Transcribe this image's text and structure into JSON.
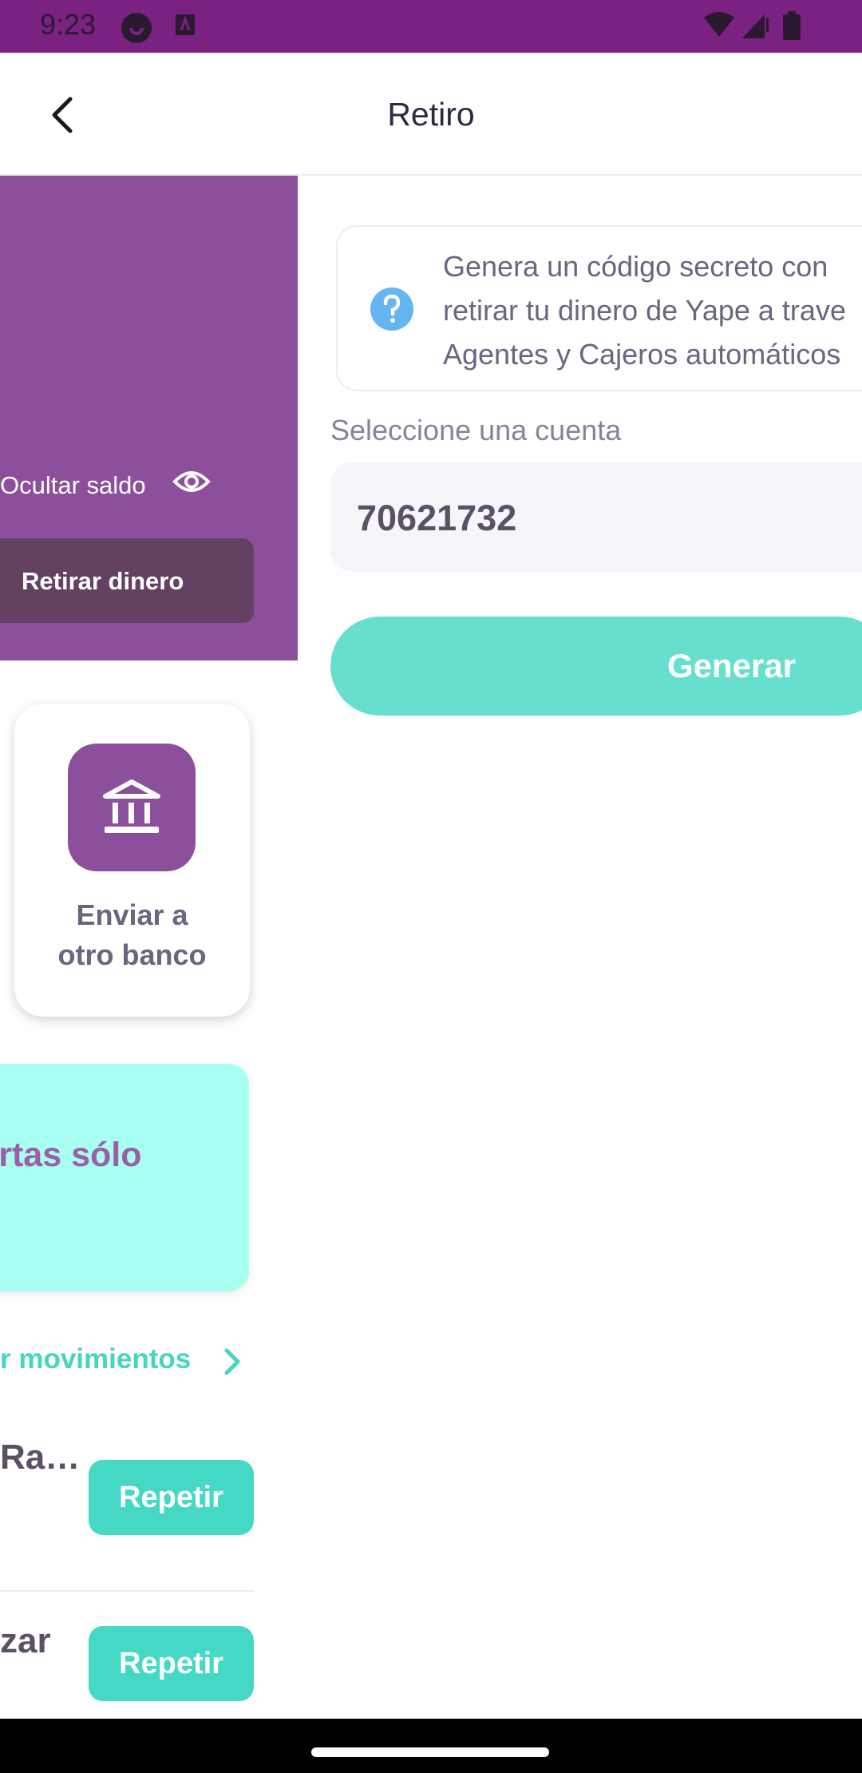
{
  "status_bar": {
    "time": "9:23",
    "icons": [
      "app-notification-icon",
      "app-notification-icon",
      "wifi-icon",
      "signal-icon",
      "battery-icon"
    ],
    "background_color": "#7a2182"
  },
  "header": {
    "title": "Retiro",
    "back_icon": "chevron-left-icon"
  },
  "background_screen": {
    "hide_balance_label": "Ocultar saldo",
    "withdraw_button_label": "Retirar dinero",
    "bank_shortcut_label_line1": "Enviar a",
    "bank_shortcut_label_line2": "otro banco",
    "promo_text": "fertas sólo",
    "movements_link": "r movimientos",
    "rows": [
      {
        "name": "Ra…",
        "repeat_label": "Repetir"
      },
      {
        "name": "zar",
        "repeat_label": "Repetir"
      }
    ]
  },
  "info_card": {
    "text": "Genera un código secreto con\nretirar tu dinero de Yape a trave\nAgentes y Cajeros automáticos"
  },
  "account": {
    "label": "Seleccione una cuenta",
    "value": "70621732"
  },
  "generate_button_label": "Generar",
  "colors": {
    "brand_purple": "#8c4f9b",
    "accent_teal": "#45d8c5",
    "promo_bg": "#a8fff1"
  }
}
